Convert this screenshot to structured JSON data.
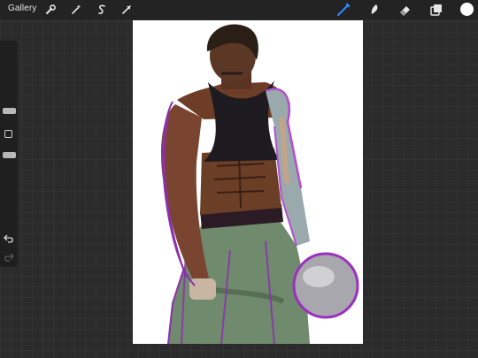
{
  "topbar": {
    "gallery_label": "Gallery",
    "left_tools": [
      "wrench-icon",
      "magic-wand-icon",
      "selection-icon",
      "transform-icon"
    ],
    "right_tools": [
      "brush-icon",
      "smudge-icon",
      "eraser-icon",
      "layers-icon"
    ],
    "active_tool": "brush",
    "current_color": "#ffffff",
    "accent_color": "#2f8cff"
  },
  "sidebar": {
    "controls": [
      "brush-size-slider",
      "modify-button",
      "opacity-slider",
      "undo-button",
      "redo-button"
    ]
  },
  "canvas": {
    "background": "#ffffff"
  }
}
